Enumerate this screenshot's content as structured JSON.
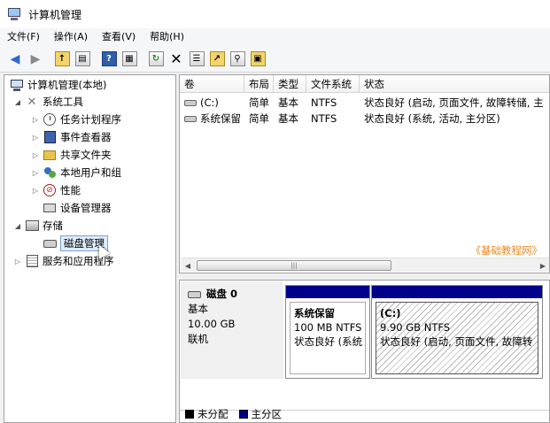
{
  "window": {
    "title": "计算机管理"
  },
  "menu": [
    {
      "label": "文件(F)"
    },
    {
      "label": "操作(A)"
    },
    {
      "label": "查看(V)"
    },
    {
      "label": "帮助(H)"
    }
  ],
  "toolbar": {
    "icons": [
      "back-icon",
      "forward-icon",
      "up-folder-icon",
      "show-tree-icon",
      "help-icon",
      "action-pane-icon",
      "refresh-icon",
      "delete-icon",
      "properties-icon",
      "open-icon",
      "search-icon",
      "export-icon"
    ]
  },
  "tree": {
    "root": "计算机管理(本地)",
    "system_tools": "系统工具",
    "task_scheduler": "任务计划程序",
    "event_viewer": "事件查看器",
    "shared_folders": "共享文件夹",
    "local_users": "本地用户和组",
    "performance": "性能",
    "device_manager": "设备管理器",
    "storage": "存储",
    "disk_management": "磁盘管理",
    "services": "服务和应用程序"
  },
  "volumes": {
    "columns": [
      "卷",
      "布局",
      "类型",
      "文件系统",
      "状态"
    ],
    "rows": [
      {
        "volume": "(C:)",
        "layout": "简单",
        "type": "基本",
        "fs": "NTFS",
        "status": "状态良好 (启动, 页面文件, 故障转储, 主"
      },
      {
        "volume": "系统保留",
        "layout": "简单",
        "type": "基本",
        "fs": "NTFS",
        "status": "状态良好 (系统, 活动, 主分区)"
      }
    ]
  },
  "watermark": "《基础教程网》",
  "disk": {
    "name": "磁盘 0",
    "type": "基本",
    "size": "10.00 GB",
    "status": "联机",
    "partitions": [
      {
        "name": "系统保留",
        "size": "100 MB NTFS",
        "status": "状态良好 (系统"
      },
      {
        "name": "(C:)",
        "size": "9.90 GB NTFS",
        "status": "状态良好 (启动, 页面文件, 故障转"
      }
    ]
  },
  "legend": {
    "unallocated": "未分配",
    "primary": "主分区",
    "unallocated_color": "#000000",
    "primary_color": "#00008b"
  }
}
